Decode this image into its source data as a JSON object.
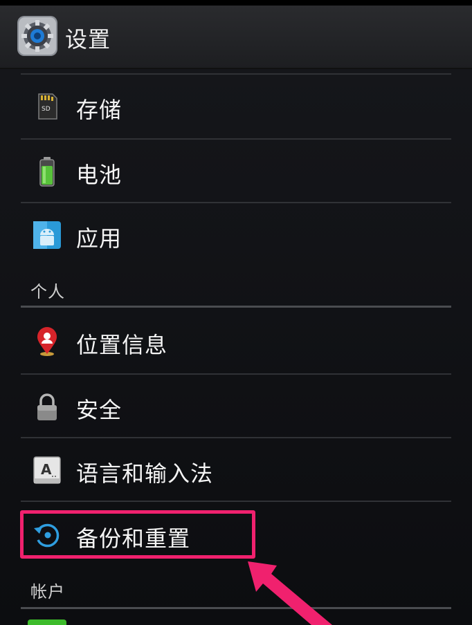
{
  "header": {
    "title": "设置",
    "icon": "settings-gear-icon"
  },
  "items": [
    {
      "label": "存储",
      "icon": "sd-card-icon"
    },
    {
      "label": "电池",
      "icon": "battery-icon"
    },
    {
      "label": "应用",
      "icon": "android-apps-icon"
    },
    {
      "label": "位置信息",
      "icon": "location-pin-icon"
    },
    {
      "label": "安全",
      "icon": "lock-icon"
    },
    {
      "label": "语言和输入法",
      "icon": "keyboard-a-icon"
    },
    {
      "label": "备份和重置",
      "icon": "backup-restore-icon"
    }
  ],
  "categories": {
    "personal": "个人",
    "accounts": "帐户"
  },
  "colors": {
    "highlight": "#f0216e",
    "battery": "#57c23a",
    "background": "#0b0b0d"
  }
}
